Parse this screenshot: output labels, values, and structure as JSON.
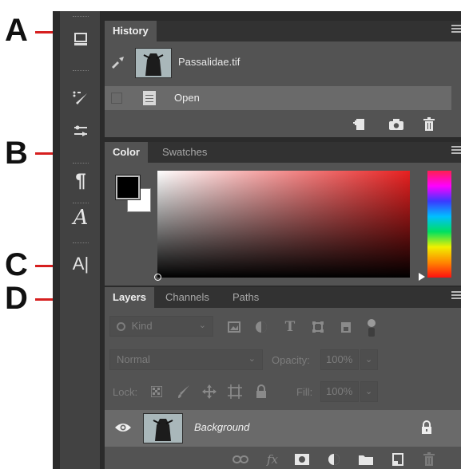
{
  "callouts": {
    "a": "A",
    "b": "B",
    "c": "C",
    "d": "D"
  },
  "history": {
    "tab": "History",
    "snapshot_name": "Passalidae.tif",
    "state_label": "Open"
  },
  "color": {
    "tabs": [
      "Color",
      "Swatches"
    ],
    "foreground": "#000000",
    "background": "#ffffff",
    "hue_color": "#e82020"
  },
  "layers": {
    "tabs": [
      "Layers",
      "Channels",
      "Paths"
    ],
    "filter_placeholder": "Kind",
    "blend_mode": "Normal",
    "opacity_label": "Opacity:",
    "opacity_value": "100%",
    "lock_label": "Lock:",
    "fill_label": "Fill:",
    "fill_value": "100%",
    "layer_name": "Background"
  },
  "tools": {
    "character_glyph": "A",
    "text_tool_glyph": "A|",
    "paragraph_glyph": "¶"
  }
}
